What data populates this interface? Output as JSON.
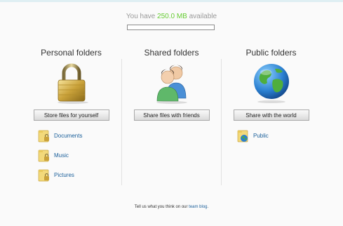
{
  "quota": {
    "prefix": "You have ",
    "amount": "250.0 MB",
    "suffix": " available",
    "used_fraction": 0.0
  },
  "columns": [
    {
      "heading": "Personal folders",
      "icon": "padlock-icon",
      "button": "Store files for yourself",
      "folders": [
        "Documents",
        "Music",
        "Pictures"
      ]
    },
    {
      "heading": "Shared folders",
      "icon": "users-icon",
      "button": "Share files with friends",
      "folders": []
    },
    {
      "heading": "Public folders",
      "icon": "globe-icon",
      "button": "Share with the world",
      "folders": [
        "Public"
      ]
    }
  ],
  "footer": {
    "prefix": "Tell us what you think on our ",
    "link": "team blog",
    "suffix": "."
  },
  "colors": {
    "accent_green": "#66cc33",
    "link_blue": "#1a5f9a"
  }
}
